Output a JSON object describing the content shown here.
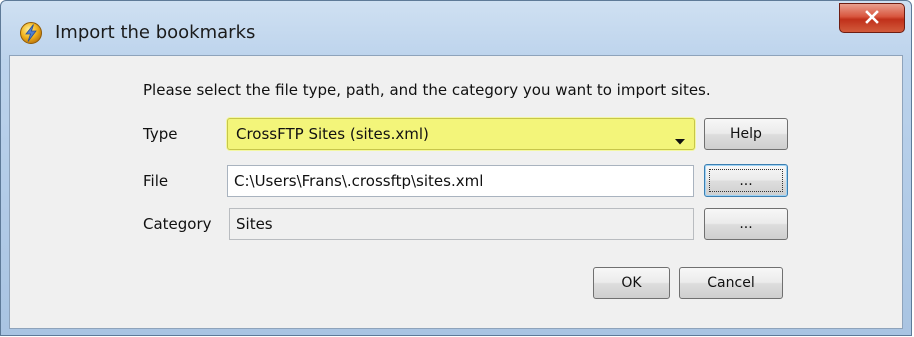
{
  "window": {
    "title": "Import the bookmarks"
  },
  "dialog": {
    "prompt": "Please select the file type, path, and the category you want to import sites.",
    "type": {
      "label": "Type",
      "selected": "CrossFTP Sites (sites.xml)"
    },
    "file": {
      "label": "File",
      "value": "C:\\Users\\Frans\\.crossftp\\sites.xml"
    },
    "category": {
      "label": "Category",
      "value": "Sites"
    },
    "buttons": {
      "help": "Help",
      "browse_file": "...",
      "browse_category": "...",
      "ok": "OK",
      "cancel": "Cancel"
    }
  },
  "colors": {
    "highlight": "#f3f57a",
    "close_button": "#c0301a",
    "titlebar": "#bcd3ec"
  },
  "icons": {
    "app": "lightning-bolt-icon",
    "close": "close-icon",
    "dropdown": "chevron-down-icon"
  }
}
